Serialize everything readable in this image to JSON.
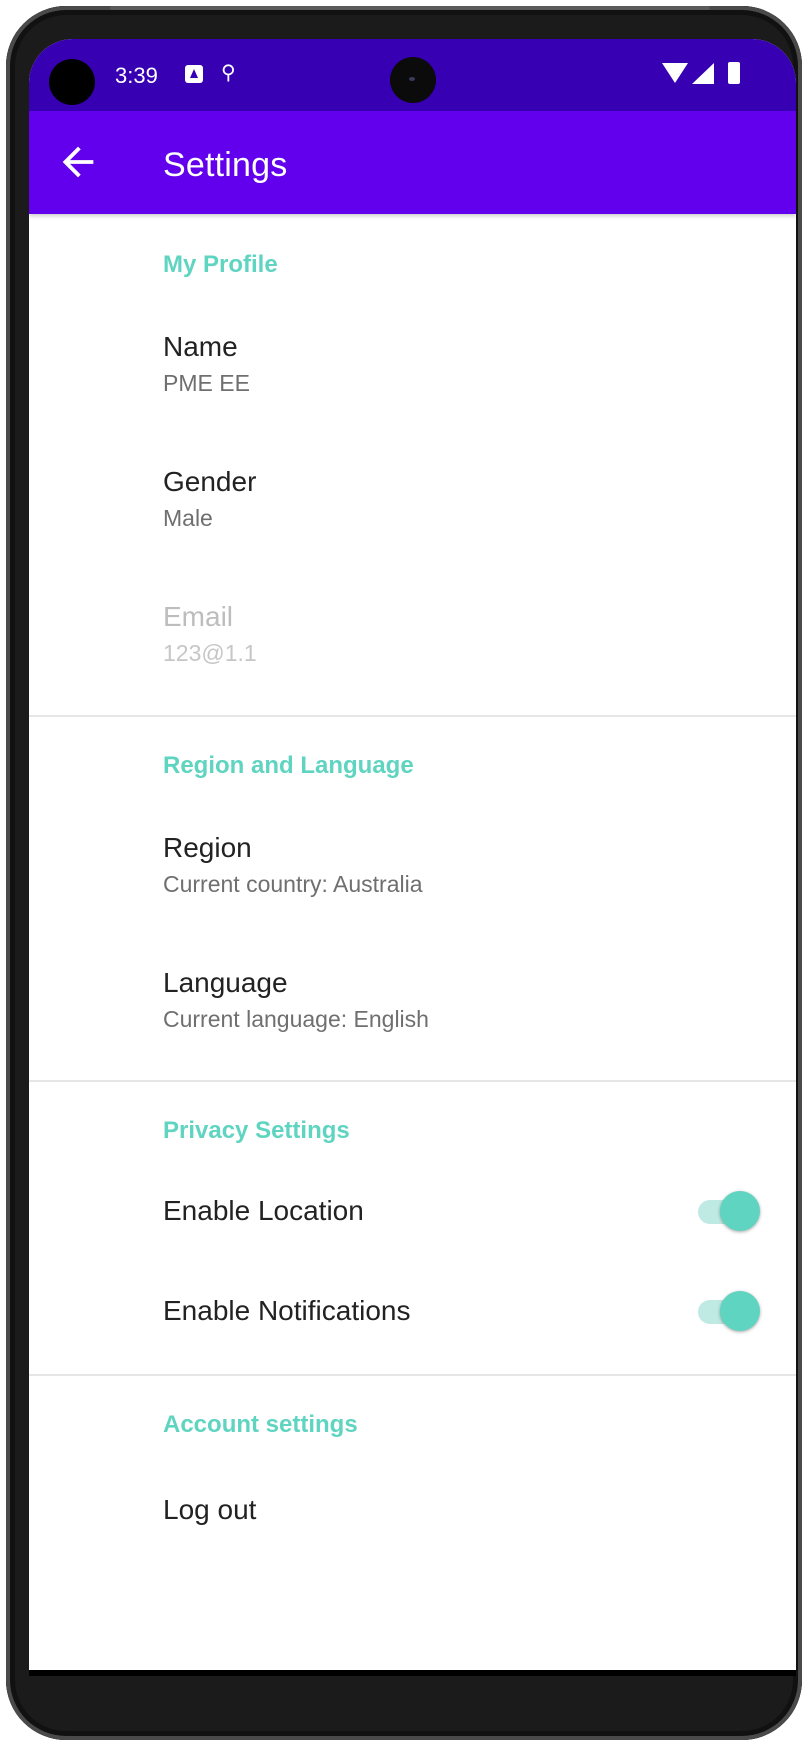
{
  "status_bar": {
    "time": "3:39",
    "icons": [
      "a-notification-icon",
      "location-notification-icon",
      "wifi-icon",
      "signal-icon",
      "battery-icon"
    ]
  },
  "app_bar": {
    "title": "Settings",
    "back_icon": "arrow-back-icon"
  },
  "sections": {
    "profile": {
      "header": "My Profile",
      "name": {
        "title": "Name",
        "summary": "PME EE"
      },
      "gender": {
        "title": "Gender",
        "summary": "Male"
      },
      "email": {
        "title": "Email",
        "summary": "123@1.1",
        "enabled": false
      }
    },
    "region": {
      "header": "Region and Language",
      "region": {
        "title": "Region",
        "summary": "Current country: Australia"
      },
      "language": {
        "title": "Language",
        "summary": "Current language: English"
      }
    },
    "privacy": {
      "header": "Privacy Settings",
      "location": {
        "title": "Enable Location",
        "checked": true
      },
      "notifications": {
        "title": "Enable Notifications",
        "checked": true
      }
    },
    "account": {
      "header": "Account settings",
      "logout": {
        "title": "Log out"
      }
    }
  },
  "colors": {
    "status_bar": "#3700b3",
    "app_bar": "#6200ee",
    "accent": "#5fd4c0",
    "accent_track": "#bfeae3"
  }
}
